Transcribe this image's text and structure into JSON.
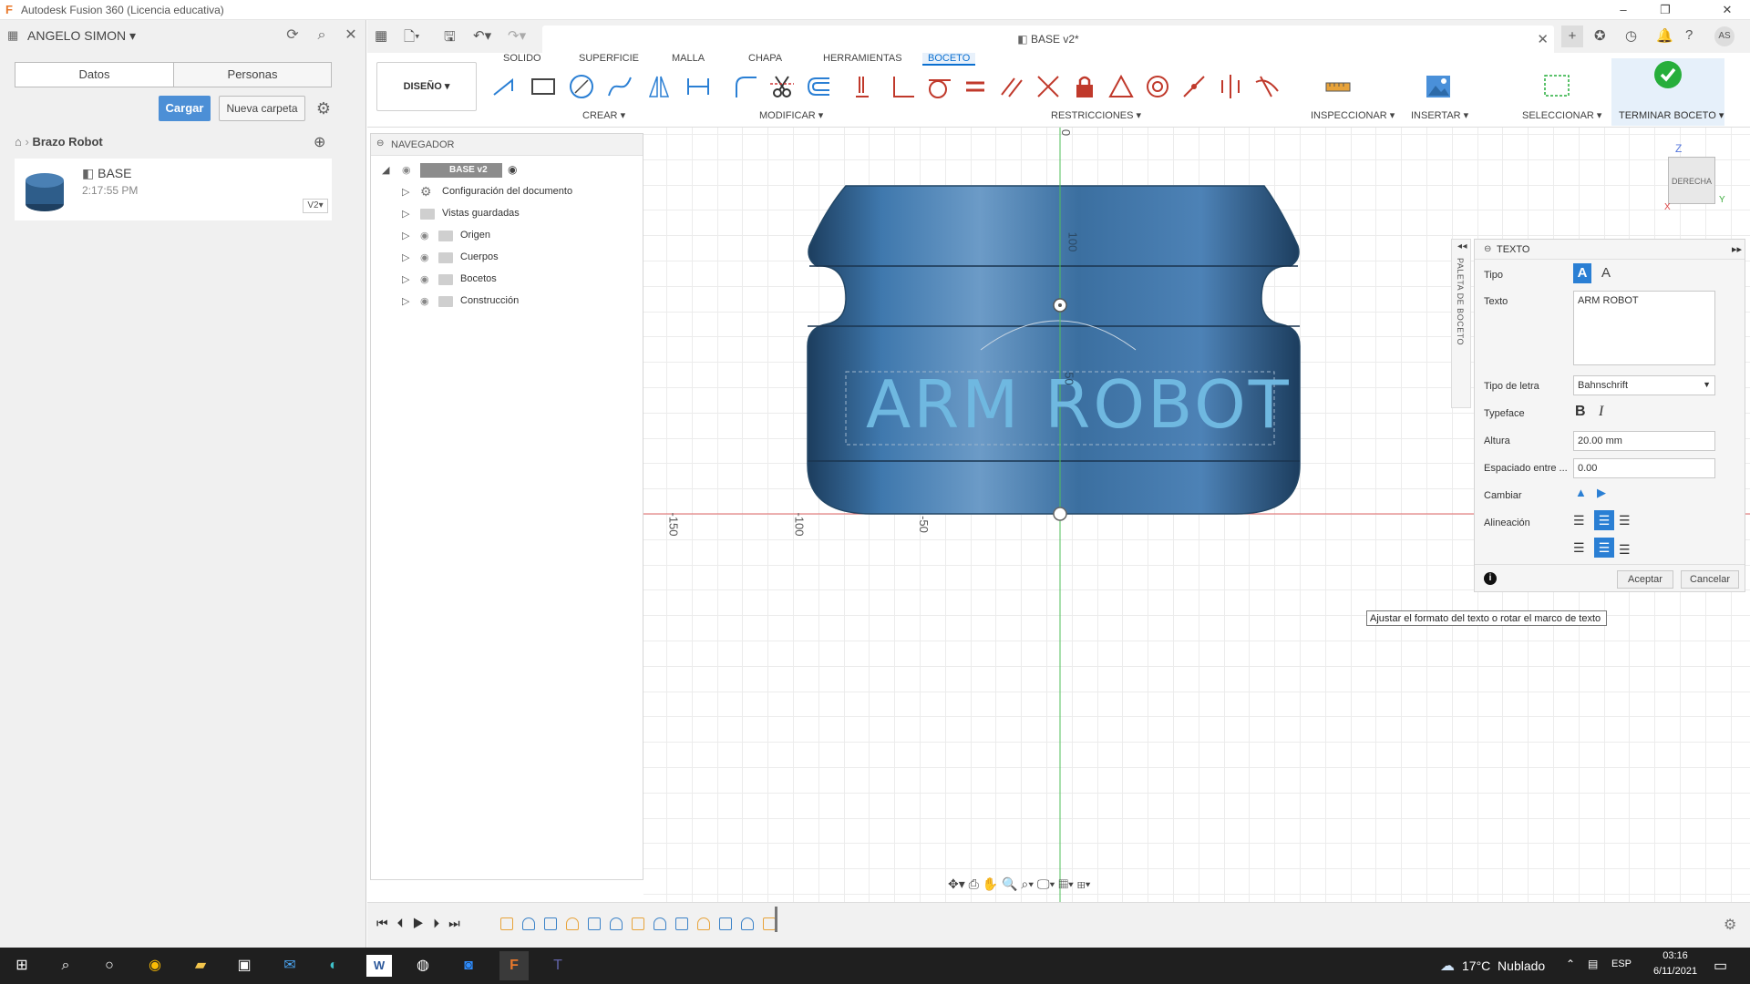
{
  "window": {
    "title": "Autodesk Fusion 360 (Licencia educativa)"
  },
  "data_panel": {
    "user": "ANGELO SIMON",
    "tabs": [
      "Datos",
      "Personas"
    ],
    "load_button": "Cargar",
    "new_folder_button": "Nueva carpeta",
    "breadcrumb": "Brazo Robot",
    "file": {
      "name": "BASE",
      "time": "2:17:55 PM",
      "version": "V2"
    }
  },
  "document": {
    "tab_title": "BASE v2*"
  },
  "ribbon": {
    "workspace": "DISEÑO",
    "tabs": [
      "SOLIDO",
      "SUPERFICIE",
      "MALLA",
      "CHAPA",
      "HERRAMIENTAS",
      "BOCETO"
    ],
    "active_tab": "BOCETO",
    "groups": [
      "CREAR",
      "MODIFICAR",
      "RESTRICCIONES",
      "INSPECCIONAR",
      "INSERTAR",
      "SELECCIONAR",
      "TERMINAR BOCETO"
    ]
  },
  "navigator": {
    "header": "NAVEGADOR",
    "root": "BASE v2",
    "items": [
      "Configuración del documento",
      "Vistas guardadas",
      "Origen",
      "Cuerpos",
      "Bocetos",
      "Construcción"
    ]
  },
  "viewport": {
    "sketch_text": "ARM ROBOT",
    "axis_labels_x": [
      "-150",
      "-100",
      "-50"
    ],
    "axis_labels_y": [
      "0",
      "100",
      "50"
    ],
    "viewcube": {
      "face": "DERECHA",
      "axis_z": "Z",
      "axis_y": "Y",
      "axis_x": "X"
    }
  },
  "sketch_palette": {
    "label": "PALETA DE BOCETO"
  },
  "text_dialog": {
    "title": "TEXTO",
    "fields": {
      "tipo": "Tipo",
      "texto": "Texto",
      "texto_value": "ARM ROBOT",
      "tipo_letra": "Tipo de letra",
      "tipo_letra_value": "Bahnschrift",
      "typeface": "Typeface",
      "altura": "Altura",
      "altura_value": "20.00 mm",
      "espaciado": "Espaciado entre ...",
      "espaciado_value": "0.00",
      "cambiar": "Cambiar",
      "alineacion": "Alineación"
    },
    "ok": "Aceptar",
    "cancel": "Cancelar"
  },
  "tooltip": "Ajustar el formato del texto o rotar el marco de texto",
  "taskbar": {
    "weather": "17°C  Nublado",
    "lang": "ESP",
    "time": "03:16",
    "date": "6/11/2021"
  },
  "colors": {
    "accent": "#0a6fd0",
    "model": "#3b6fa0",
    "finish": "#27ae3b",
    "taskbar": "#1f1f1f"
  }
}
